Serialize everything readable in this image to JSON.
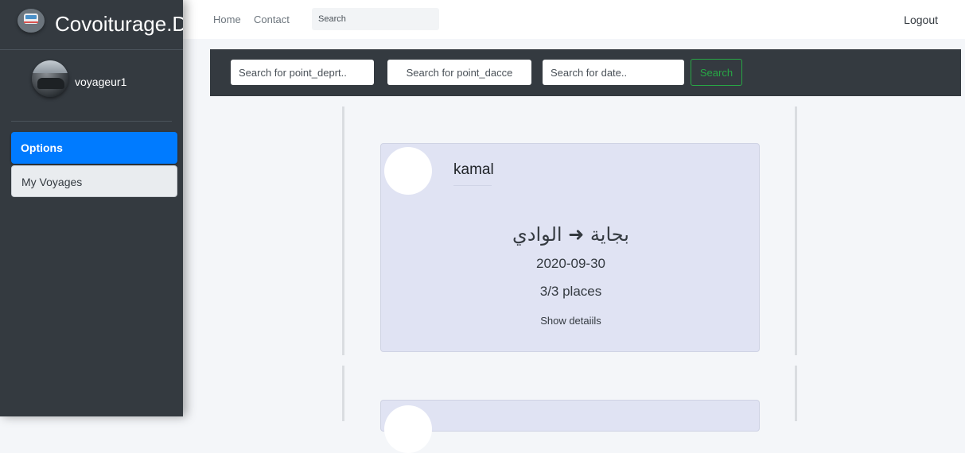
{
  "brand": {
    "name": "Covoiturage.D",
    "icon": "bus-icon"
  },
  "user": {
    "name": "voyageur1"
  },
  "sidebar": {
    "items": [
      {
        "label": "Options",
        "active": true
      },
      {
        "label": "My Voyages",
        "active": false
      }
    ]
  },
  "topnav": {
    "links": [
      "Home",
      "Contact"
    ],
    "search_placeholder": "Search",
    "logout": "Logout"
  },
  "filters": {
    "departure_placeholder": "Search for point_deprt..",
    "arrival_placeholder": "Search for point_dacce",
    "date_placeholder": "Search for date..",
    "button": "Search"
  },
  "voyages": [
    {
      "driver": "kamal",
      "route": "بجاية ➜ الوادي",
      "date": "2020-09-30",
      "places": "3/3 places",
      "details_link": "Show detaiils"
    }
  ],
  "colors": {
    "sidebar_bg": "#343a40",
    "active_item": "#007bff",
    "search_button": "#28a745",
    "card_bg": "#e0e3f3"
  }
}
